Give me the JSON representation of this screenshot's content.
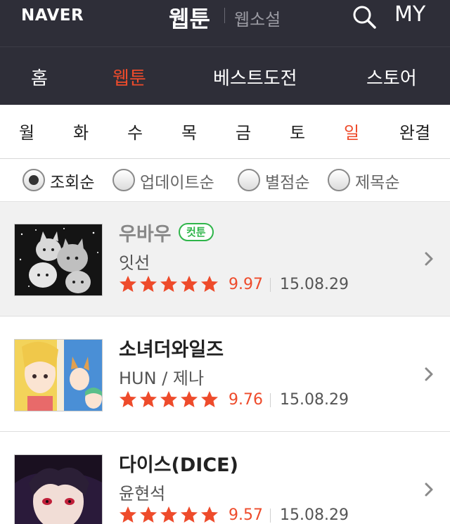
{
  "header": {
    "logo": "NAVER",
    "title": "웹툰",
    "subtitle": "웹소설",
    "my_label": "MY",
    "search_icon": "search-icon"
  },
  "nav": {
    "items": [
      {
        "label": "홈",
        "active": false
      },
      {
        "label": "웹툰",
        "active": true
      },
      {
        "label": "베스트도전",
        "active": false
      },
      {
        "label": "스토어",
        "active": false
      }
    ]
  },
  "days": {
    "items": [
      {
        "label": "월",
        "active": false
      },
      {
        "label": "화",
        "active": false
      },
      {
        "label": "수",
        "active": false
      },
      {
        "label": "목",
        "active": false
      },
      {
        "label": "금",
        "active": false
      },
      {
        "label": "토",
        "active": false
      },
      {
        "label": "일",
        "active": true
      },
      {
        "label": "완결",
        "active": false
      }
    ]
  },
  "sort": {
    "options": [
      {
        "label": "조회순",
        "checked": true
      },
      {
        "label": "업데이트순",
        "checked": false
      },
      {
        "label": "별점순",
        "checked": false
      },
      {
        "label": "제목순",
        "checked": false
      }
    ]
  },
  "webtoons": [
    {
      "title": "우바우",
      "badge": "컷툰",
      "author": "잇선",
      "rating": "9.97",
      "stars": 5,
      "date": "15.08.29"
    },
    {
      "title": "소녀더와일즈",
      "badge": "",
      "author": "HUN / 제나",
      "rating": "9.76",
      "stars": 5,
      "date": "15.08.29"
    },
    {
      "title": "다이스(DICE)",
      "badge": "",
      "author": "윤현석",
      "rating": "9.57",
      "stars": 5,
      "date": "15.08.29"
    }
  ],
  "colors": {
    "header_bg": "#2e2e38",
    "accent": "#ee4b2b",
    "badge_green": "#2fb54a"
  }
}
